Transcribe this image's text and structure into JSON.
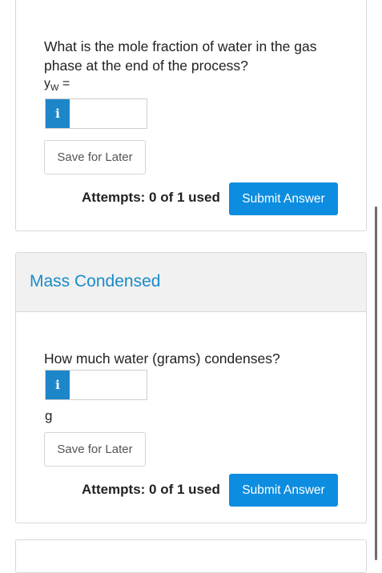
{
  "q1": {
    "question": "What is the mole fraction of water in the gas phase at the end of the process?",
    "var_main": "y",
    "var_sub": "W",
    "var_eq": " =",
    "info_label": "i",
    "save_label": "Save for Later",
    "attempts": "Attempts: 0 of 1 used",
    "submit_label": "Submit Answer"
  },
  "q2": {
    "section_title": "Mass Condensed",
    "question": "How much water (grams) condenses?",
    "info_label": "i",
    "unit": "g",
    "save_label": "Save for Later",
    "attempts": "Attempts: 0 of 1 used",
    "submit_label": "Submit Answer"
  },
  "colors": {
    "accent": "#0d8de0",
    "info": "#1d86c9",
    "section_title": "#1a8bc8"
  }
}
